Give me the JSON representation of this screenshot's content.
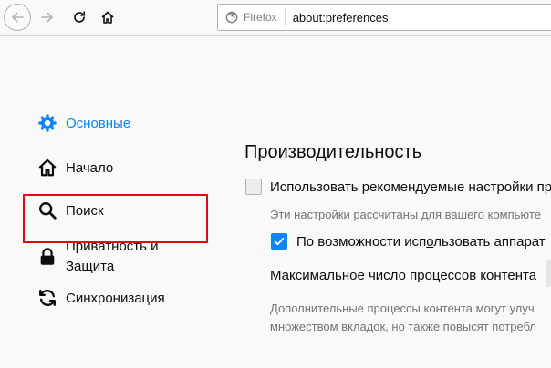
{
  "toolbar": {
    "identity_label": "Firefox",
    "url": "about:preferences"
  },
  "sidebar": {
    "items": [
      {
        "label": "Основные",
        "icon": "gear-icon",
        "selected": true
      },
      {
        "label": "Начало",
        "icon": "home-icon"
      },
      {
        "label": "Поиск",
        "icon": "search-icon"
      },
      {
        "label_line1": "Приватность и",
        "label_line2": "Защита",
        "icon": "lock-icon"
      },
      {
        "label": "Синхронизация",
        "icon": "sync-icon"
      }
    ]
  },
  "main": {
    "section_title": "Производительность",
    "recommended": {
      "label_pre": "Использовать рекомен",
      "label_accel": "д",
      "label_post": "уемые настройки пр",
      "checked": false,
      "description": "Эти настройки рассчитаны для вашего компьюте"
    },
    "hw_accel": {
      "label_pre": "По возможности исп",
      "label_accel": "о",
      "label_post": "льзовать аппарат",
      "checked": true
    },
    "processes": {
      "label_pre": "Максимальное число процесс",
      "label_accel": "о",
      "label_post": "в контента",
      "description_line1": "Дополнительные процессы контента могут улуч",
      "description_line2": "множеством вкладок, но также повысят потребл"
    }
  },
  "colors": {
    "accent": "#0a84ff",
    "highlight": "#e30613"
  }
}
